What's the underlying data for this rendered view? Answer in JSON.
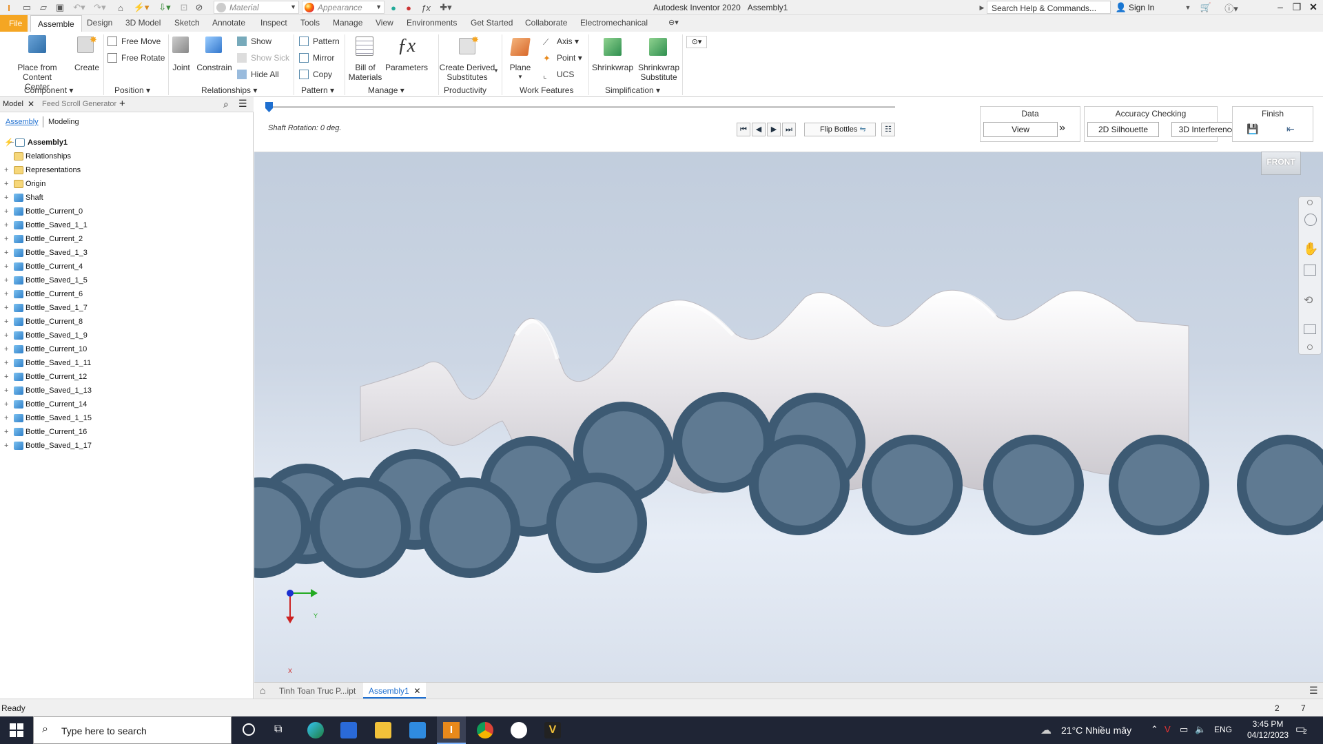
{
  "titlebar": {
    "material": "Material",
    "appearance": "Appearance",
    "app_title": "Autodesk Inventor 2020",
    "doc_title": "Assembly1",
    "help_search": "Search Help & Commands...",
    "sign_in": "Sign In"
  },
  "tabs": [
    "File",
    "Assemble",
    "Design",
    "3D Model",
    "Sketch",
    "Annotate",
    "Inspect",
    "Tools",
    "Manage",
    "View",
    "Environments",
    "Get Started",
    "Collaborate",
    "Electromechanical"
  ],
  "ribbon": {
    "place_line1": "Place from",
    "place_line2": "Content Center",
    "create": "Create",
    "free_move": "Free Move",
    "free_rotate": "Free Rotate",
    "joint": "Joint",
    "constrain": "Constrain",
    "show": "Show",
    "show_sick": "Show Sick",
    "hide_all": "Hide All",
    "pattern": "Pattern",
    "mirror": "Mirror",
    "copy": "Copy",
    "bom_line1": "Bill of",
    "bom_line2": "Materials",
    "parameters": "Parameters",
    "cds_line1": "Create Derived",
    "cds_line2": "Substitutes",
    "plane": "Plane",
    "axis": "Axis",
    "point": "Point",
    "ucs": "UCS",
    "shrinkwrap": "Shrinkwrap",
    "sws_line1": "Shrinkwrap",
    "sws_line2": "Substitute",
    "groups": {
      "component": "Component",
      "position": "Position",
      "relationships": "Relationships",
      "pattern": "Pattern",
      "manage": "Manage",
      "productivity": "Productivity",
      "work_features": "Work Features",
      "simplification": "Simplification"
    }
  },
  "browser": {
    "model_tab": "Model",
    "feed_tab": "Feed Scroll Generator",
    "assembly_tab": "Assembly",
    "modeling_tab": "Modeling",
    "root": "Assembly1",
    "items": [
      "Relationships",
      "Representations",
      "Origin",
      "Shaft",
      "Bottle_Current_0",
      "Bottle_Saved_1_1",
      "Bottle_Current_2",
      "Bottle_Saved_1_3",
      "Bottle_Current_4",
      "Bottle_Saved_1_5",
      "Bottle_Current_6",
      "Bottle_Saved_1_7",
      "Bottle_Current_8",
      "Bottle_Saved_1_9",
      "Bottle_Current_10",
      "Bottle_Saved_1_11",
      "Bottle_Current_12",
      "Bottle_Saved_1_13",
      "Bottle_Current_14",
      "Bottle_Saved_1_15",
      "Bottle_Current_16",
      "Bottle_Saved_1_17"
    ]
  },
  "cmdbar": {
    "shaft_rotation": "Shaft Rotation: 0 deg.",
    "flip_bottles": "Flip Bottles",
    "data_header": "Data",
    "view_btn": "View",
    "accuracy_header": "Accuracy Checking",
    "silhouette_btn": "2D Silhouette",
    "interference_btn": "3D Interference",
    "finish_header": "Finish"
  },
  "viewport": {
    "viewcube_label": "FRONT",
    "axis_y": "Y",
    "axis_x": "X"
  },
  "doctabs": [
    "Tinh Toan Truc P...ipt",
    "Assembly1"
  ],
  "status": {
    "ready": "Ready",
    "count1": "2",
    "count2": "7"
  },
  "taskbar": {
    "search_placeholder": "Type here to search",
    "weather": "21°C  Nhiều mây",
    "lang": "ENG",
    "time": "3:45 PM",
    "date": "04/12/2023",
    "notif": "2"
  },
  "colors": {
    "accent": "#f5a623",
    "bottle_ring": "#3d5a73",
    "bottle_fill": "#5f7a92",
    "selected_tab": "#1e6fd0"
  }
}
